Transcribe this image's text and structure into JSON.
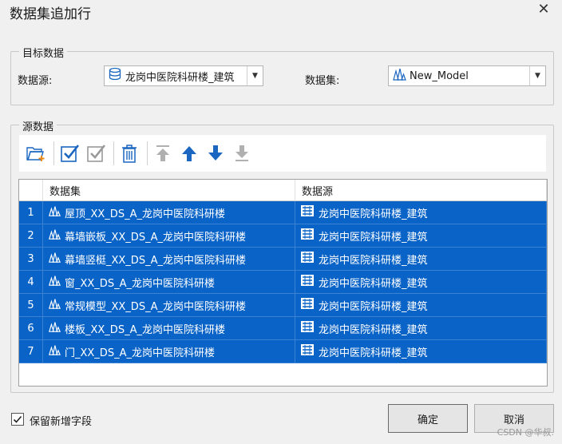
{
  "window": {
    "title": "数据集追加行",
    "close_label": "✕"
  },
  "target": {
    "legend": "目标数据",
    "datasource_label": "数据源:",
    "datasource_value": "龙岗中医院科研楼_建筑",
    "dataset_label": "数据集:",
    "dataset_value": "New_Model"
  },
  "source": {
    "legend": "源数据",
    "toolbar": [
      "open-folder",
      "select-all",
      "deselect-all",
      "delete",
      "move-top",
      "move-up",
      "move-down",
      "move-bottom"
    ],
    "columns": [
      "数据集",
      "数据源"
    ],
    "rows": [
      {
        "num": "1",
        "dataset": "屋顶_XX_DS_A_龙岗中医院科研楼",
        "datasource": "龙岗中医院科研楼_建筑"
      },
      {
        "num": "2",
        "dataset": "幕墙嵌板_XX_DS_A_龙岗中医院科研楼",
        "datasource": "龙岗中医院科研楼_建筑"
      },
      {
        "num": "3",
        "dataset": "幕墙竖梃_XX_DS_A_龙岗中医院科研楼",
        "datasource": "龙岗中医院科研楼_建筑"
      },
      {
        "num": "4",
        "dataset": "窗_XX_DS_A_龙岗中医院科研楼",
        "datasource": "龙岗中医院科研楼_建筑"
      },
      {
        "num": "5",
        "dataset": "常规模型_XX_DS_A_龙岗中医院科研楼",
        "datasource": "龙岗中医院科研楼_建筑"
      },
      {
        "num": "6",
        "dataset": "楼板_XX_DS_A_龙岗中医院科研楼",
        "datasource": "龙岗中医院科研楼_建筑"
      },
      {
        "num": "7",
        "dataset": "门_XX_DS_A_龙岗中医院科研楼",
        "datasource": "龙岗中医院科研楼_建筑"
      }
    ]
  },
  "footer": {
    "keep_fields_label": "保留新增字段",
    "keep_fields_checked": true,
    "ok_label": "确定",
    "cancel_label": "取消",
    "watermark": "CSDN @华叔."
  },
  "colors": {
    "selection": "#0a64c8",
    "icon_blue": "#1a66c0"
  }
}
